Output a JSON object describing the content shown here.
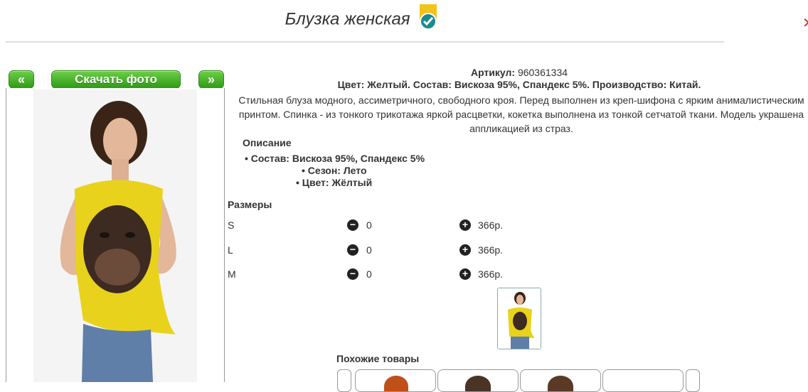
{
  "header": {
    "title": "Блузка женская"
  },
  "gallery": {
    "prev_label": "«",
    "next_label": "»",
    "download_label": "Скачать фото"
  },
  "product": {
    "article_label": "Артикул:",
    "article_value": "960361334",
    "summary": "Цвет: Желтый. Состав: Вискоза 95%, Спандекс 5%. Производство: Китай.",
    "description": "Стильная блуза модного, ассиметричного, свободного кроя. Перед выполнен из креп-шифона с ярким анималистическим принтом. Спинка - из тонкого трикотажа яркой расцветки, кокетка выполнена из тонкой сетчатой ткани. Модель украшена аппликацией из страз.",
    "description_heading": "Описание",
    "bullets": [
      "Состав: Вискоза 95%, Спандекс 5%",
      "Сезон: Лето",
      "Цвет: Жёлтый"
    ]
  },
  "sizes": {
    "heading": "Размеры",
    "rows": [
      {
        "name": "S",
        "qty": "0",
        "price": "366р."
      },
      {
        "name": "L",
        "qty": "0",
        "price": "366р."
      },
      {
        "name": "M",
        "qty": "0",
        "price": "366р."
      }
    ]
  },
  "similar": {
    "heading": "Похожие товары"
  },
  "colors": {
    "accent_green": "#3aa81f",
    "badge_teal": "#1a8a8f",
    "badge_yellow": "#f2c318",
    "shirt_yellow": "#e8d21c"
  }
}
